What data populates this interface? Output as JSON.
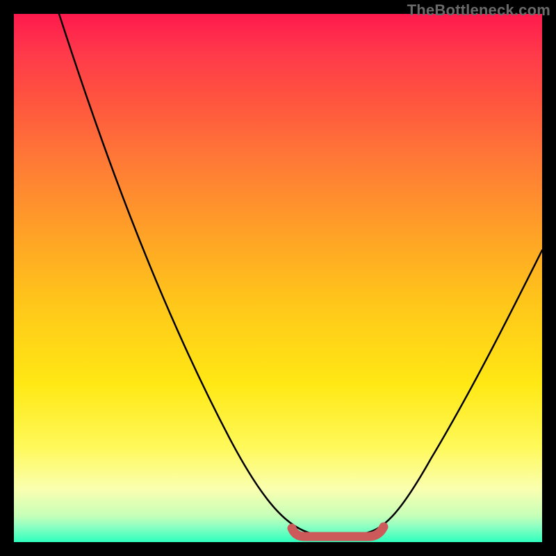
{
  "watermark": "TheBottleneck.com",
  "chart_data": {
    "type": "line",
    "title": "",
    "xlabel": "",
    "ylabel": "",
    "xlim": [
      0,
      100
    ],
    "ylim": [
      0,
      100
    ],
    "x": [
      0,
      10,
      20,
      30,
      40,
      45,
      50,
      55,
      60,
      65,
      70,
      80,
      90,
      100
    ],
    "values": [
      100,
      84,
      67,
      49,
      32,
      23,
      14,
      6,
      2,
      1,
      2,
      10,
      24,
      40
    ],
    "trough": {
      "x_start": 53,
      "x_end": 70,
      "y": 1
    },
    "curve_stroke": "#000000",
    "trough_stroke": "#cc5a5a",
    "gradient_stops": [
      {
        "p": 0,
        "c": "#ff1a4d"
      },
      {
        "p": 50,
        "c": "#ffc71a"
      },
      {
        "p": 90,
        "c": "#faffb0"
      },
      {
        "p": 100,
        "c": "#2effbd"
      }
    ]
  }
}
